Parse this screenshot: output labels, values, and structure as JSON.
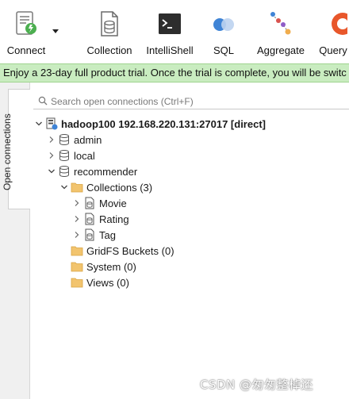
{
  "toolbar": {
    "connect_label": "Connect",
    "collection_label": "Collection",
    "intellishell_label": "IntelliShell",
    "sql_label": "SQL",
    "aggregate_label": "Aggregate",
    "query_label": "Query"
  },
  "banner": {
    "text": "Enjoy a 23-day full product trial. Once the trial is complete, you will be switc"
  },
  "sidebar": {
    "open_connections_tab": "Open connections"
  },
  "search": {
    "placeholder": "Search open connections (Ctrl+F)"
  },
  "tree": {
    "connection": "hadoop100 192.168.220.131:27017 [direct]",
    "databases": [
      "admin",
      "local",
      "recommender"
    ],
    "collections_folder": "Collections (3)",
    "collections": [
      "Movie",
      "Rating",
      "Tag"
    ],
    "gridfs_folder": "GridFS Buckets (0)",
    "system_folder": "System (0)",
    "views_folder": "Views (0)"
  },
  "watermark": "CSDN @匆匆整棹还",
  "colors": {
    "banner_bg": "#c9ecc0",
    "folder": "#f2c46e",
    "sql_blue": "#3f84d6"
  }
}
